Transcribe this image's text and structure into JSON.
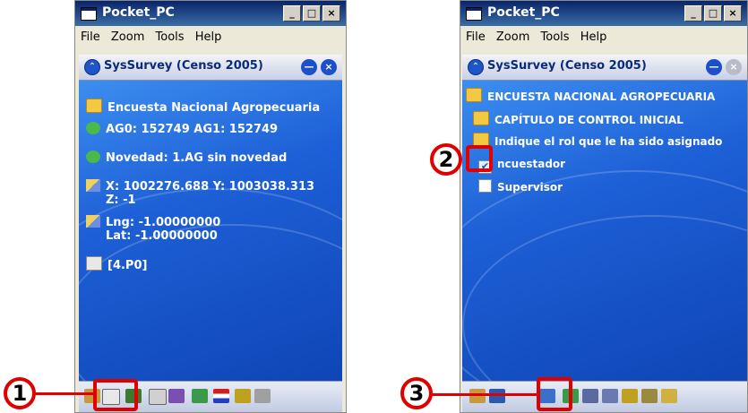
{
  "windows": [
    {
      "title": "Pocket_PC",
      "controls": [
        "_",
        "□",
        "×"
      ],
      "menu": [
        "File",
        "Zoom",
        "Tools",
        "Help"
      ],
      "app_title": "SysSurvey  (Censo 2005)",
      "rows": [
        {
          "icon": "folder-icon",
          "text": "Encuesta Nacional Agropecuaria"
        },
        {
          "icon": "map-icon",
          "text": "AG0: 152749    AG1: 152749"
        },
        {
          "icon": "person-icon",
          "text": "Novedad:  1.AG sin novedad"
        },
        {
          "icon": "coordinate-icon",
          "text": "X: 1002276.688   Y: 1003038.313",
          "text2": "Z: -1"
        },
        {
          "icon": "coordinate-icon",
          "text": "Lng: -1.00000000",
          "text2": "Lat: -1.00000000"
        },
        {
          "icon": "edit-icon",
          "text": "[4.P0]"
        }
      ]
    },
    {
      "title": "Pocket_PC",
      "controls": [
        "_",
        "□",
        "×"
      ],
      "menu": [
        "File",
        "Zoom",
        "Tools",
        "Help"
      ],
      "app_title": "SysSurvey  (Censo 2005)",
      "rows": [
        {
          "icon": "folder-icon",
          "text": "ENCUESTA NACIONAL AGROPECUARIA"
        },
        {
          "icon": "folder-icon",
          "text": "CAPÍTULO DE CONTROL INICIAL"
        },
        {
          "icon": "folder-icon",
          "text": "Indique el rol que le ha sido asignado"
        },
        {
          "icon": "checkbox-checked-icon",
          "text": "ncuestador"
        },
        {
          "icon": "checkbox-empty-icon",
          "text": "Supervisor"
        }
      ]
    }
  ],
  "callouts": [
    "1",
    "2",
    "3"
  ],
  "colors": {
    "callout": "#e10000",
    "screen": "#1f5fc9"
  }
}
